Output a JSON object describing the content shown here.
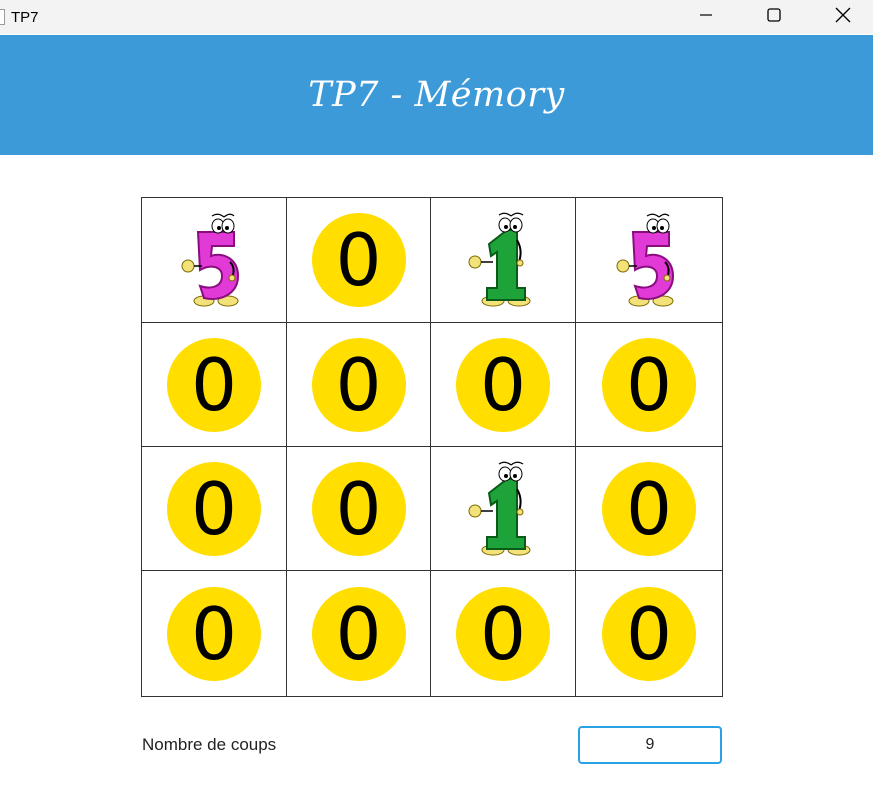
{
  "window": {
    "title": "TP7",
    "minimize_icon": "minimize-icon",
    "maximize_icon": "maximize-icon",
    "close_icon": "close-icon"
  },
  "header": {
    "title": "TP7 - Mémory",
    "background": "#3d9ad9"
  },
  "board": {
    "rows": 4,
    "cols": 4,
    "hidden_face": "0",
    "hidden_color": "#ffde00",
    "cells": [
      [
        "card-5-icon",
        "0",
        "card-1-icon",
        "card-5-icon"
      ],
      [
        "0",
        "0",
        "0",
        "0"
      ],
      [
        "0",
        "0",
        "card-1-icon",
        "0"
      ],
      [
        "0",
        "0",
        "0",
        "0"
      ]
    ]
  },
  "footer": {
    "moves_label": "Nombre de coups",
    "moves_value": "9"
  }
}
